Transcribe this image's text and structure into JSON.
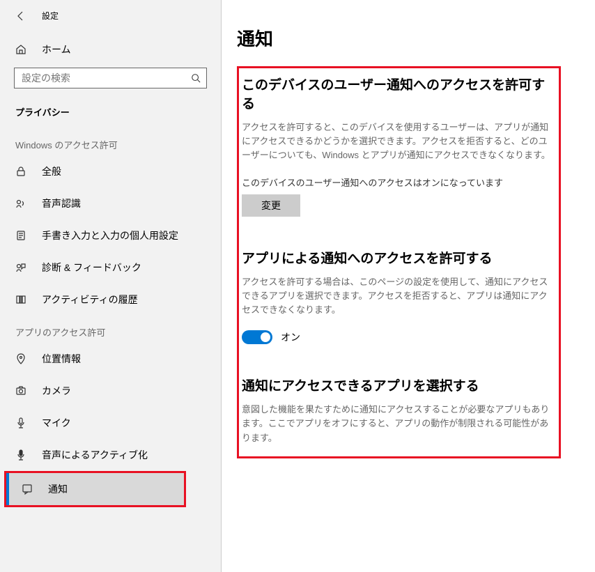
{
  "titlebar": {
    "label": "設定"
  },
  "home": {
    "label": "ホーム"
  },
  "search": {
    "placeholder": "設定の検索"
  },
  "category": "プライバシー",
  "windows_header": "Windows のアクセス許可",
  "windows_items": [
    {
      "label": "全般"
    },
    {
      "label": "音声認識"
    },
    {
      "label": "手書き入力と入力の個人用設定"
    },
    {
      "label": "診断 & フィードバック"
    },
    {
      "label": "アクティビティの履歴"
    }
  ],
  "app_header": "アプリのアクセス許可",
  "app_items": [
    {
      "label": "位置情報"
    },
    {
      "label": "カメラ"
    },
    {
      "label": "マイク"
    },
    {
      "label": "音声によるアクティブ化"
    },
    {
      "label": "通知"
    }
  ],
  "page": {
    "title": "通知",
    "sec1": {
      "title": "このデバイスのユーザー通知へのアクセスを許可する",
      "desc": "アクセスを許可すると、このデバイスを使用するユーザーは、アプリが通知にアクセスできるかどうかを選択できます。アクセスを拒否すると、どのユーザーについても、Windows とアプリが通知にアクセスできなくなります。",
      "status": "このデバイスのユーザー通知へのアクセスはオンになっています",
      "button": "変更"
    },
    "sec2": {
      "title": "アプリによる通知へのアクセスを許可する",
      "desc": "アクセスを許可する場合は、このページの設定を使用して、通知にアクセスできるアプリを選択できます。アクセスを拒否すると、アプリは通知にアクセスできなくなります。",
      "toggle_label": "オン"
    },
    "sec3": {
      "title": "通知にアクセスできるアプリを選択する",
      "desc": "意図した機能を果たすために通知にアクセスすることが必要なアプリもあります。ここでアプリをオフにすると、アプリの動作が制限される可能性があります。"
    }
  }
}
